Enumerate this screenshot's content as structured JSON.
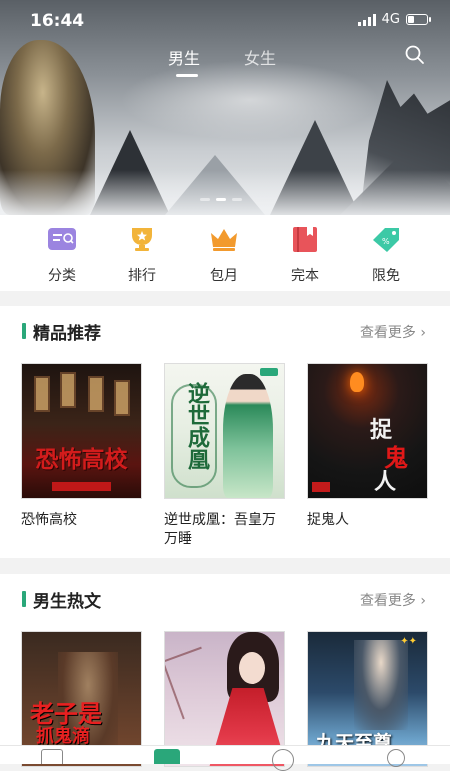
{
  "status_bar": {
    "time": "16:44",
    "network": "4G",
    "battery_level": 0.35
  },
  "header": {
    "tabs": [
      {
        "label": "男生",
        "active": true
      },
      {
        "label": "女生",
        "active": false
      }
    ],
    "search_icon": "search-icon"
  },
  "banner": {
    "page_count": 3,
    "active_page": 2
  },
  "quick_nav": [
    {
      "label": "分类",
      "icon": "category-icon",
      "color": "#9b84e0"
    },
    {
      "label": "排行",
      "icon": "trophy-icon",
      "color": "#f2b43a"
    },
    {
      "label": "包月",
      "icon": "crown-icon",
      "color": "#f29a2e"
    },
    {
      "label": "完本",
      "icon": "book-icon",
      "color": "#e8545a"
    },
    {
      "label": "限免",
      "icon": "tag-icon",
      "color": "#3cc9a6"
    }
  ],
  "sections": [
    {
      "title": "精品推荐",
      "more": "查看更多 ›",
      "books": [
        {
          "title": "恐怖高校",
          "cover_text": "恐怖高校"
        },
        {
          "title": "逆世成凰：吾皇万万睡",
          "cover_text": "逆世成凰"
        },
        {
          "title": "捉鬼人",
          "cover_text": "捉鬼人"
        }
      ]
    },
    {
      "title": "男生热文",
      "more": "查看更多 ›",
      "books": [
        {
          "cover_text_1": "老子是",
          "cover_text_2": "抓鬼滴"
        },
        {
          "title": ""
        },
        {
          "cover_text": "九天至尊"
        }
      ]
    }
  ],
  "bottom_nav": [
    {
      "icon": "bookshelf-icon"
    },
    {
      "icon": "bookstore-icon",
      "active": true
    },
    {
      "icon": "compass-icon"
    },
    {
      "icon": "profile-icon"
    }
  ],
  "colors": {
    "accent": "#2aa77a",
    "text_primary": "#222222",
    "text_secondary": "#888888"
  }
}
